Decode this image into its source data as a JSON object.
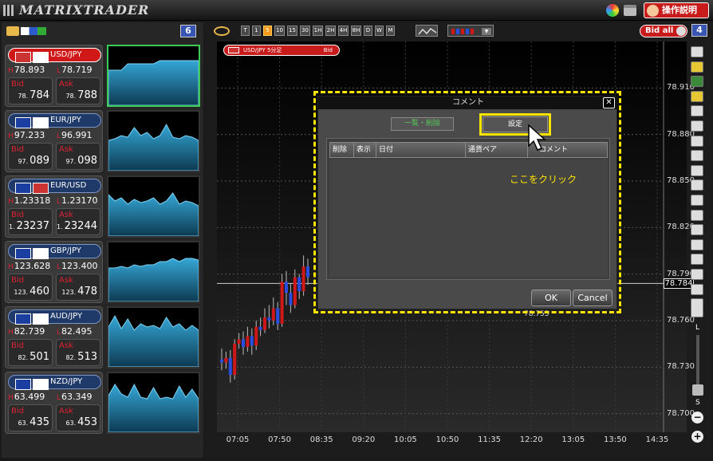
{
  "app": {
    "logo": "MATRIXTRADER",
    "help_label": "操作説明"
  },
  "left_panel": {
    "count": "6"
  },
  "tiles": [
    {
      "pair": "USD/JPY",
      "high_tag": "H",
      "high": "78.893",
      "low_tag": "L",
      "low": "78.719",
      "bid_label": "Bid",
      "bid_small": "78.",
      "bid_big": "784",
      "ask_label": "Ask",
      "ask_small": "78.",
      "ask_big": "788",
      "flags": [
        "#c33",
        "#fff"
      ]
    },
    {
      "pair": "EUR/JPY",
      "high_tag": "H",
      "high": "97.233",
      "low_tag": "L",
      "low": "96.991",
      "bid_label": "Bid",
      "bid_small": "97.",
      "bid_big": "089",
      "ask_label": "Ask",
      "ask_small": "97.",
      "ask_big": "098",
      "flags": [
        "#1a3fa0",
        "#fff"
      ]
    },
    {
      "pair": "EUR/USD",
      "high_tag": "H",
      "high": "1.23318",
      "low_tag": "L",
      "low": "1.23170",
      "bid_label": "Bid",
      "bid_small": "1.",
      "bid_big": "23237",
      "ask_label": "Ask",
      "ask_small": "1.",
      "ask_big": "23244",
      "flags": [
        "#1a3fa0",
        "#c33"
      ]
    },
    {
      "pair": "GBP/JPY",
      "high_tag": "H",
      "high": "123.628",
      "low_tag": "L",
      "low": "123.400",
      "bid_label": "Bid",
      "bid_small": "123.",
      "bid_big": "460",
      "ask_label": "Ask",
      "ask_small": "123.",
      "ask_big": "478",
      "flags": [
        "#1a3fa0",
        "#fff"
      ]
    },
    {
      "pair": "AUD/JPY",
      "high_tag": "H",
      "high": "82.739",
      "low_tag": "L",
      "low": "82.495",
      "bid_label": "Bid",
      "bid_small": "82.",
      "bid_big": "501",
      "ask_label": "Ask",
      "ask_small": "82.",
      "ask_big": "513",
      "flags": [
        "#1a3fa0",
        "#fff"
      ]
    },
    {
      "pair": "NZD/JPY",
      "high_tag": "H",
      "high": "63.499",
      "low_tag": "L",
      "low": "63.349",
      "bid_label": "Bid",
      "bid_small": "63.",
      "bid_big": "435",
      "ask_label": "Ask",
      "ask_small": "63.",
      "ask_big": "453",
      "flags": [
        "#1a3fa0",
        "#fff"
      ]
    }
  ],
  "chart": {
    "timeframes": [
      "T",
      "1",
      "5",
      "10",
      "15",
      "30",
      "1H",
      "2H",
      "4H",
      "8H",
      "D",
      "W",
      "M"
    ],
    "selected_timeframe": "5",
    "bid_all_label": "Bid all",
    "count": "4",
    "symbol_tab": "USD/JPY 5分足",
    "symbol_side": "Bid",
    "current_price": "78.784",
    "current_price_value": 78.784,
    "y_labels": [
      "78.910",
      "78.880",
      "78.850",
      "78.820",
      "78.790",
      "78.760",
      "78.730",
      "78.700"
    ],
    "x_labels": [
      "07:05",
      "07:50",
      "08:35",
      "09:20",
      "10:05",
      "10:50",
      "11:35",
      "12:20",
      "13:05",
      "13:50",
      "14:35"
    ],
    "ylim": [
      78.688,
      78.94
    ],
    "price_label_below_dialog": "78.755",
    "candles": [
      {
        "o": 78.735,
        "c": 78.733,
        "h": 78.742,
        "l": 78.728
      },
      {
        "o": 78.733,
        "c": 78.736,
        "h": 78.74,
        "l": 78.729
      },
      {
        "o": 78.736,
        "c": 78.725,
        "h": 78.741,
        "l": 78.72
      },
      {
        "o": 78.725,
        "c": 78.745,
        "h": 78.748,
        "l": 78.722
      },
      {
        "o": 78.745,
        "c": 78.748,
        "h": 78.752,
        "l": 78.742
      },
      {
        "o": 78.748,
        "c": 78.743,
        "h": 78.753,
        "l": 78.738
      },
      {
        "o": 78.743,
        "c": 78.75,
        "h": 78.756,
        "l": 78.74
      },
      {
        "o": 78.75,
        "c": 78.744,
        "h": 78.755,
        "l": 78.738
      },
      {
        "o": 78.744,
        "c": 78.756,
        "h": 78.76,
        "l": 78.741
      },
      {
        "o": 78.756,
        "c": 78.754,
        "h": 78.762,
        "l": 78.75
      },
      {
        "o": 78.754,
        "c": 78.762,
        "h": 78.768,
        "l": 78.752
      },
      {
        "o": 78.762,
        "c": 78.76,
        "h": 78.77,
        "l": 78.755
      },
      {
        "o": 78.76,
        "c": 78.768,
        "h": 78.775,
        "l": 78.757
      },
      {
        "o": 78.768,
        "c": 78.758,
        "h": 78.772,
        "l": 78.754
      },
      {
        "o": 78.758,
        "c": 78.785,
        "h": 78.79,
        "l": 78.756
      },
      {
        "o": 78.785,
        "c": 78.778,
        "h": 78.792,
        "l": 78.77
      },
      {
        "o": 78.778,
        "c": 78.77,
        "h": 78.784,
        "l": 78.765
      },
      {
        "o": 78.77,
        "c": 78.788,
        "h": 78.793,
        "l": 78.768
      },
      {
        "o": 78.788,
        "c": 78.779,
        "h": 78.79,
        "l": 78.774
      },
      {
        "o": 78.779,
        "c": 78.795,
        "h": 78.802,
        "l": 78.776
      },
      {
        "o": 78.795,
        "c": 78.788,
        "h": 78.8,
        "l": 78.783
      }
    ]
  },
  "dialog": {
    "title": "コメント",
    "close_label": "✕",
    "list_label": "一覧・削除",
    "set_label": "設定",
    "columns": [
      "削除",
      "表示",
      "日付",
      "通貨ペア",
      "コメント"
    ],
    "annotation": "ここをクリック",
    "ok_label": "OK",
    "cancel_label": "Cancel"
  },
  "slider": {
    "top_label": "L",
    "bottom_label": "S"
  },
  "colors": {
    "bull": "#d01818",
    "bear": "#2b4de0",
    "spark_fill": "#2a8fb8",
    "accent": "#ffe500"
  }
}
